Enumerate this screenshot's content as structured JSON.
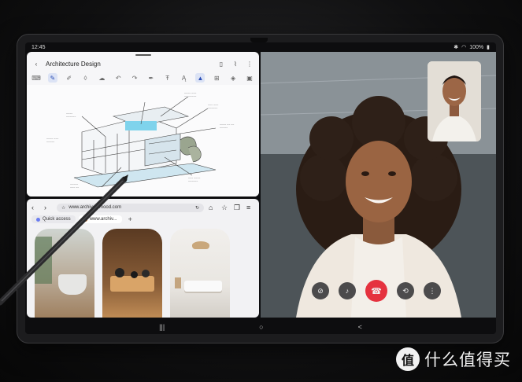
{
  "status_bar": {
    "time": "12:45",
    "battery": "100%"
  },
  "notes": {
    "title": "Architecture Design",
    "header_icons": [
      "book-icon",
      "paperclip-icon",
      "more-vert-icon"
    ],
    "toolbar": [
      "keyboard-icon",
      "pen-icon",
      "highlighter-icon",
      "eraser-icon",
      "lasso-icon",
      "undo-icon",
      "redo-icon",
      "pen-settings-icon",
      "text-format-icon",
      "text-icon",
      "shape-icon",
      "insert-icon",
      "shapes-icon",
      "more-icon"
    ]
  },
  "browser": {
    "url": "www.archiveofmood.com",
    "tabs": [
      {
        "label": "Quick access"
      },
      {
        "label": "www.archiv..."
      }
    ],
    "new_tab": "+"
  },
  "call": {
    "controls": [
      "video-off-icon",
      "mic-off-icon",
      "end-call-icon",
      "switch-camera-icon",
      "more-vert-icon"
    ],
    "colors": {
      "end_call": "#e5323f"
    }
  },
  "watermark": {
    "glyph": "值",
    "text": "什么值得买"
  },
  "nav": {
    "recents": "|||",
    "home": "○",
    "back": "<"
  }
}
